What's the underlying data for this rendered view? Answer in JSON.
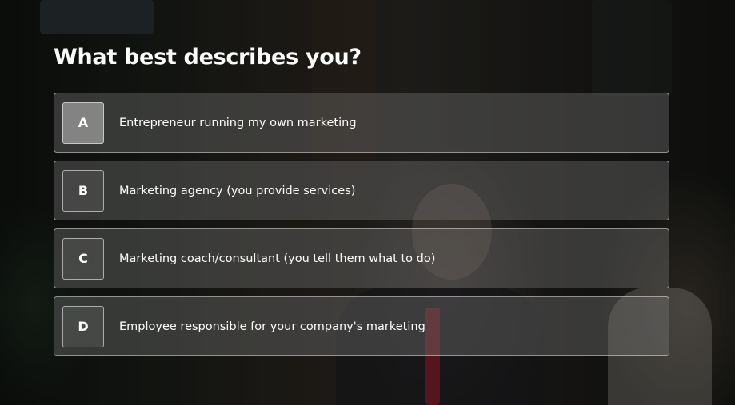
{
  "question": {
    "title": "What best describes you?"
  },
  "options": [
    {
      "key": "A",
      "label": "Entrepreneur running my own marketing",
      "selected": true
    },
    {
      "key": "B",
      "label": "Marketing agency (you provide services)",
      "selected": false
    },
    {
      "key": "C",
      "label": "Marketing coach/consultant (you tell them what to do)",
      "selected": false
    },
    {
      "key": "D",
      "label": "Employee responsible for your company's marketing",
      "selected": false
    }
  ],
  "colors": {
    "text": "#ffffff",
    "option_background": "#787878",
    "option_border": "#bdbdbd"
  }
}
